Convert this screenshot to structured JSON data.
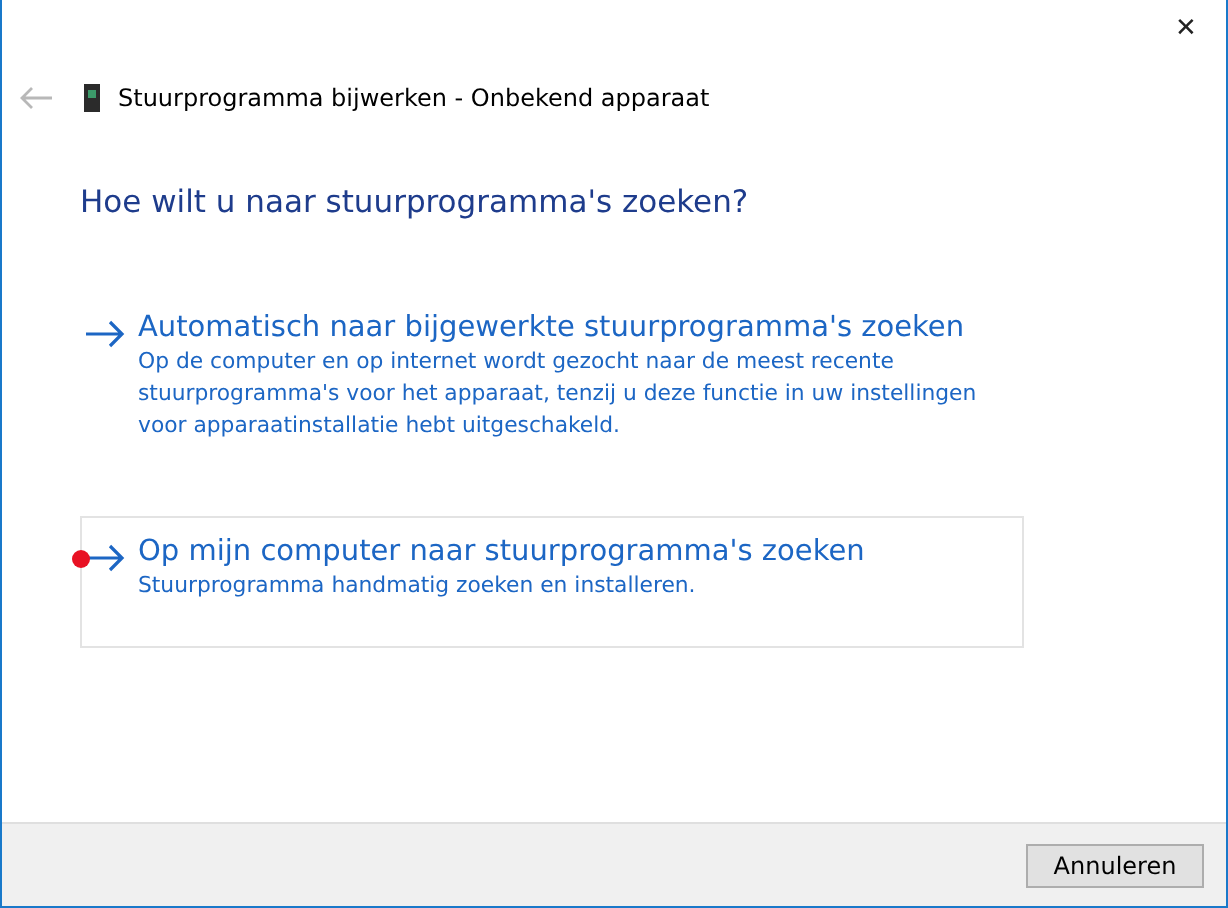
{
  "window": {
    "close": "✕",
    "title": "Stuurprogramma bijwerken - Onbekend apparaat"
  },
  "heading": "Hoe wilt u naar stuurprogramma's zoeken?",
  "options": [
    {
      "title": "Automatisch naar bijgewerkte stuurprogramma's zoeken",
      "description": "Op de computer en op internet wordt gezocht naar de meest recente stuurprogramma's voor het apparaat, tenzij u deze functie in uw instellingen voor apparaatinstallatie hebt uitgeschakeld.",
      "selected": false
    },
    {
      "title": "Op mijn computer naar stuurprogramma's zoeken",
      "description": "Stuurprogramma handmatig zoeken en installeren.",
      "selected": true,
      "color": "#e81123"
    }
  ],
  "buttons": [
    "Annuleren"
  ]
}
